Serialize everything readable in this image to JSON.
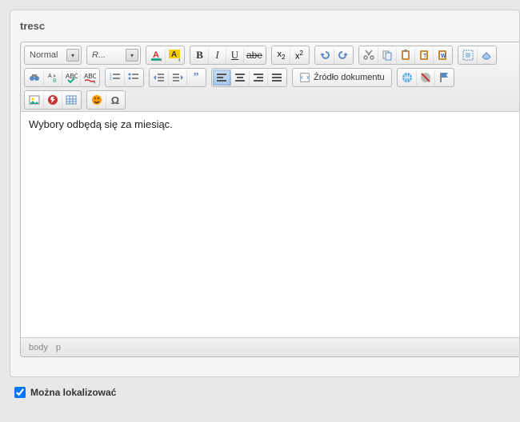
{
  "field_label": "tresc",
  "toolbar": {
    "format_combo": "Normal",
    "font_combo": "R...",
    "source_label": "Źródło dokumentu"
  },
  "content": {
    "text": "Wybory odbędą się za miesiąc."
  },
  "status": {
    "path1": "body",
    "path2": "p"
  },
  "checkbox": {
    "label": "Można lokalizować",
    "checked": true
  }
}
